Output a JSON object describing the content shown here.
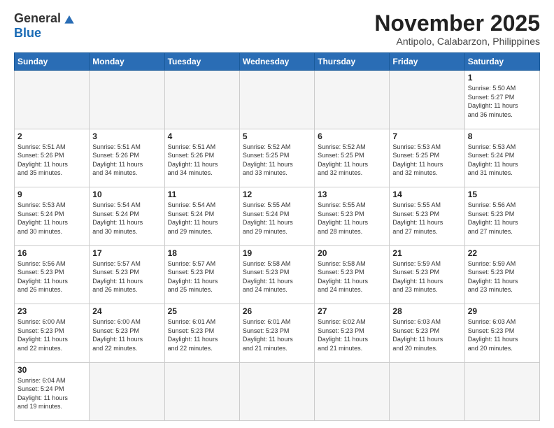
{
  "header": {
    "logo_general": "General",
    "logo_blue": "Blue",
    "month_title": "November 2025",
    "location": "Antipolo, Calabarzon, Philippines"
  },
  "weekdays": [
    "Sunday",
    "Monday",
    "Tuesday",
    "Wednesday",
    "Thursday",
    "Friday",
    "Saturday"
  ],
  "weeks": [
    [
      {
        "day": "",
        "info": ""
      },
      {
        "day": "",
        "info": ""
      },
      {
        "day": "",
        "info": ""
      },
      {
        "day": "",
        "info": ""
      },
      {
        "day": "",
        "info": ""
      },
      {
        "day": "",
        "info": ""
      },
      {
        "day": "1",
        "info": "Sunrise: 5:50 AM\nSunset: 5:27 PM\nDaylight: 11 hours\nand 36 minutes."
      }
    ],
    [
      {
        "day": "2",
        "info": "Sunrise: 5:51 AM\nSunset: 5:26 PM\nDaylight: 11 hours\nand 35 minutes."
      },
      {
        "day": "3",
        "info": "Sunrise: 5:51 AM\nSunset: 5:26 PM\nDaylight: 11 hours\nand 34 minutes."
      },
      {
        "day": "4",
        "info": "Sunrise: 5:51 AM\nSunset: 5:26 PM\nDaylight: 11 hours\nand 34 minutes."
      },
      {
        "day": "5",
        "info": "Sunrise: 5:52 AM\nSunset: 5:25 PM\nDaylight: 11 hours\nand 33 minutes."
      },
      {
        "day": "6",
        "info": "Sunrise: 5:52 AM\nSunset: 5:25 PM\nDaylight: 11 hours\nand 32 minutes."
      },
      {
        "day": "7",
        "info": "Sunrise: 5:53 AM\nSunset: 5:25 PM\nDaylight: 11 hours\nand 32 minutes."
      },
      {
        "day": "8",
        "info": "Sunrise: 5:53 AM\nSunset: 5:24 PM\nDaylight: 11 hours\nand 31 minutes."
      }
    ],
    [
      {
        "day": "9",
        "info": "Sunrise: 5:53 AM\nSunset: 5:24 PM\nDaylight: 11 hours\nand 30 minutes."
      },
      {
        "day": "10",
        "info": "Sunrise: 5:54 AM\nSunset: 5:24 PM\nDaylight: 11 hours\nand 30 minutes."
      },
      {
        "day": "11",
        "info": "Sunrise: 5:54 AM\nSunset: 5:24 PM\nDaylight: 11 hours\nand 29 minutes."
      },
      {
        "day": "12",
        "info": "Sunrise: 5:55 AM\nSunset: 5:24 PM\nDaylight: 11 hours\nand 29 minutes."
      },
      {
        "day": "13",
        "info": "Sunrise: 5:55 AM\nSunset: 5:23 PM\nDaylight: 11 hours\nand 28 minutes."
      },
      {
        "day": "14",
        "info": "Sunrise: 5:55 AM\nSunset: 5:23 PM\nDaylight: 11 hours\nand 27 minutes."
      },
      {
        "day": "15",
        "info": "Sunrise: 5:56 AM\nSunset: 5:23 PM\nDaylight: 11 hours\nand 27 minutes."
      }
    ],
    [
      {
        "day": "16",
        "info": "Sunrise: 5:56 AM\nSunset: 5:23 PM\nDaylight: 11 hours\nand 26 minutes."
      },
      {
        "day": "17",
        "info": "Sunrise: 5:57 AM\nSunset: 5:23 PM\nDaylight: 11 hours\nand 26 minutes."
      },
      {
        "day": "18",
        "info": "Sunrise: 5:57 AM\nSunset: 5:23 PM\nDaylight: 11 hours\nand 25 minutes."
      },
      {
        "day": "19",
        "info": "Sunrise: 5:58 AM\nSunset: 5:23 PM\nDaylight: 11 hours\nand 24 minutes."
      },
      {
        "day": "20",
        "info": "Sunrise: 5:58 AM\nSunset: 5:23 PM\nDaylight: 11 hours\nand 24 minutes."
      },
      {
        "day": "21",
        "info": "Sunrise: 5:59 AM\nSunset: 5:23 PM\nDaylight: 11 hours\nand 23 minutes."
      },
      {
        "day": "22",
        "info": "Sunrise: 5:59 AM\nSunset: 5:23 PM\nDaylight: 11 hours\nand 23 minutes."
      }
    ],
    [
      {
        "day": "23",
        "info": "Sunrise: 6:00 AM\nSunset: 5:23 PM\nDaylight: 11 hours\nand 22 minutes."
      },
      {
        "day": "24",
        "info": "Sunrise: 6:00 AM\nSunset: 5:23 PM\nDaylight: 11 hours\nand 22 minutes."
      },
      {
        "day": "25",
        "info": "Sunrise: 6:01 AM\nSunset: 5:23 PM\nDaylight: 11 hours\nand 22 minutes."
      },
      {
        "day": "26",
        "info": "Sunrise: 6:01 AM\nSunset: 5:23 PM\nDaylight: 11 hours\nand 21 minutes."
      },
      {
        "day": "27",
        "info": "Sunrise: 6:02 AM\nSunset: 5:23 PM\nDaylight: 11 hours\nand 21 minutes."
      },
      {
        "day": "28",
        "info": "Sunrise: 6:03 AM\nSunset: 5:23 PM\nDaylight: 11 hours\nand 20 minutes."
      },
      {
        "day": "29",
        "info": "Sunrise: 6:03 AM\nSunset: 5:23 PM\nDaylight: 11 hours\nand 20 minutes."
      }
    ],
    [
      {
        "day": "30",
        "info": "Sunrise: 6:04 AM\nSunset: 5:24 PM\nDaylight: 11 hours\nand 19 minutes."
      },
      {
        "day": "",
        "info": ""
      },
      {
        "day": "",
        "info": ""
      },
      {
        "day": "",
        "info": ""
      },
      {
        "day": "",
        "info": ""
      },
      {
        "day": "",
        "info": ""
      },
      {
        "day": "",
        "info": ""
      }
    ]
  ]
}
